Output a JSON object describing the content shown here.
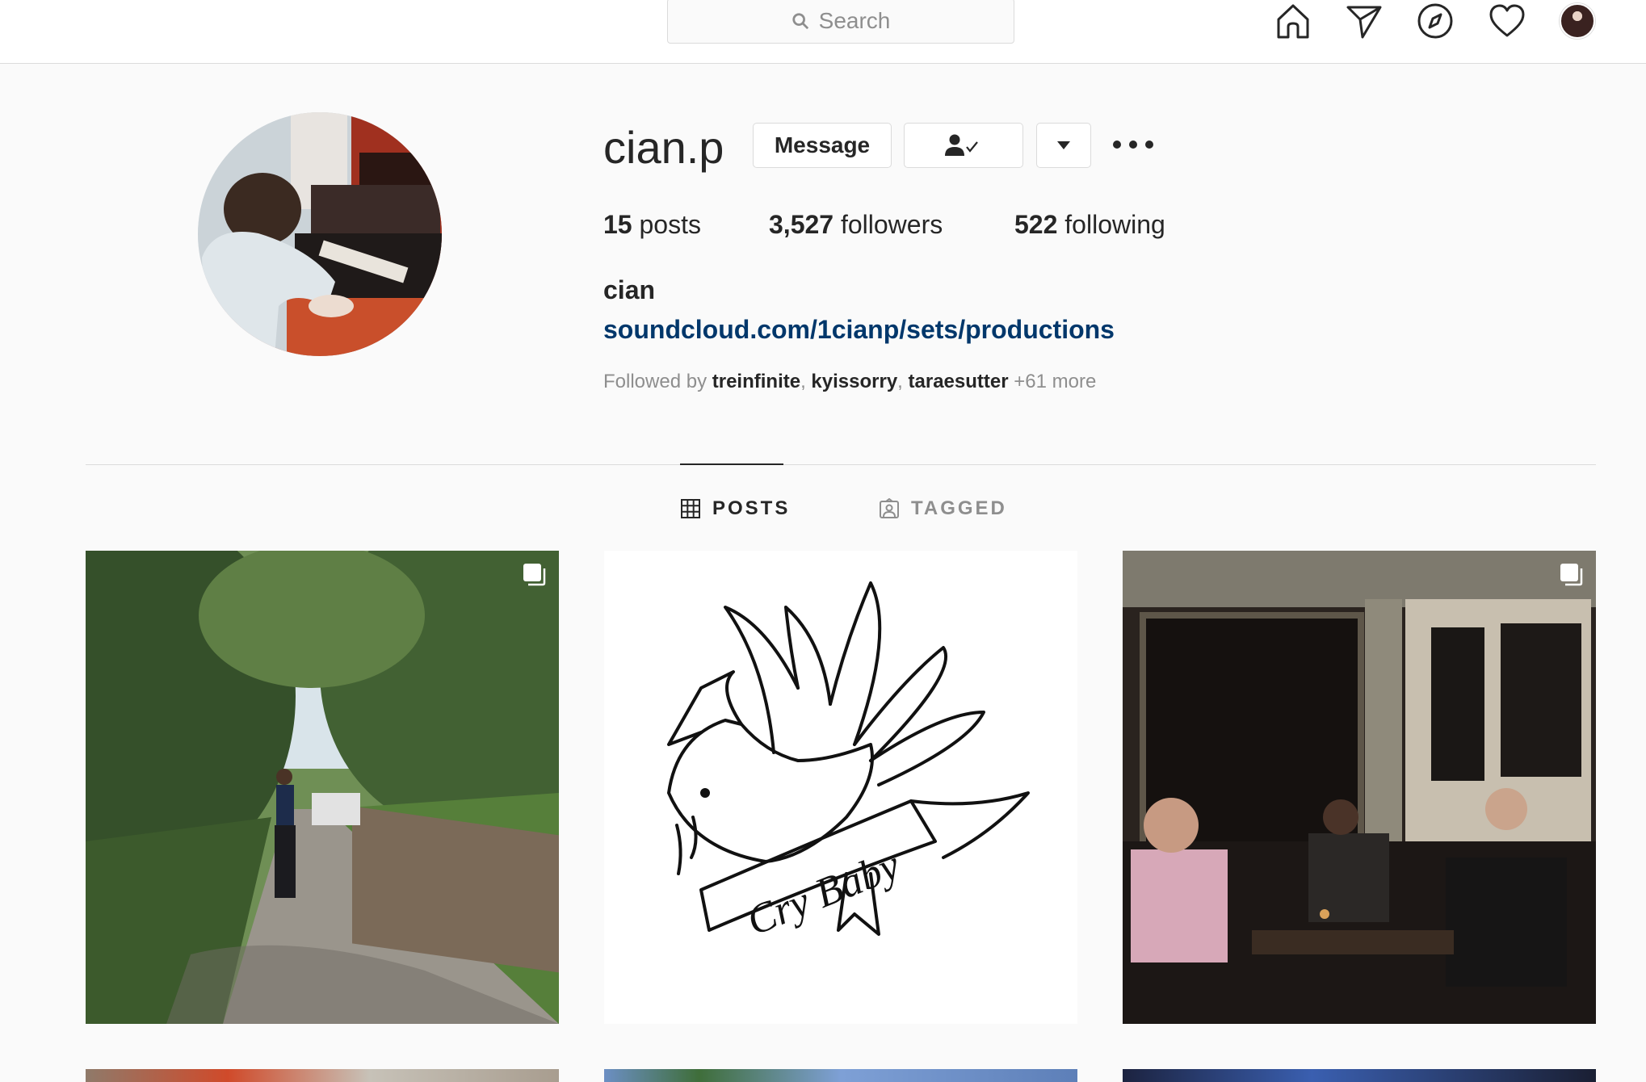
{
  "topbar": {
    "search": {
      "placeholder": "Search"
    },
    "icons": [
      "home-icon",
      "direct-icon",
      "explore-icon",
      "activity-heart-icon",
      "profile-avatar"
    ]
  },
  "profile": {
    "username": "cian.p",
    "buttons": {
      "message": "Message"
    },
    "stats": {
      "posts_count": "15",
      "posts_label": " posts",
      "followers_count": "3,527",
      "followers_label": " followers",
      "following_count": "522",
      "following_label": " following"
    },
    "full_name": "cian",
    "link": "soundcloud.com/1cianp/sets/productions",
    "followed_by": {
      "prefix": "Followed by ",
      "names": [
        "treinfinite",
        "kyissorry",
        "taraesutter"
      ],
      "suffix": " +61 more"
    }
  },
  "tabs": [
    {
      "label": "POSTS",
      "active": true
    },
    {
      "label": "TAGGED",
      "active": false
    }
  ],
  "colors": {
    "link": "#00376b",
    "text": "#262626",
    "muted": "#8e8e8e",
    "border": "#dbdbdb",
    "background": "#fafafa"
  }
}
